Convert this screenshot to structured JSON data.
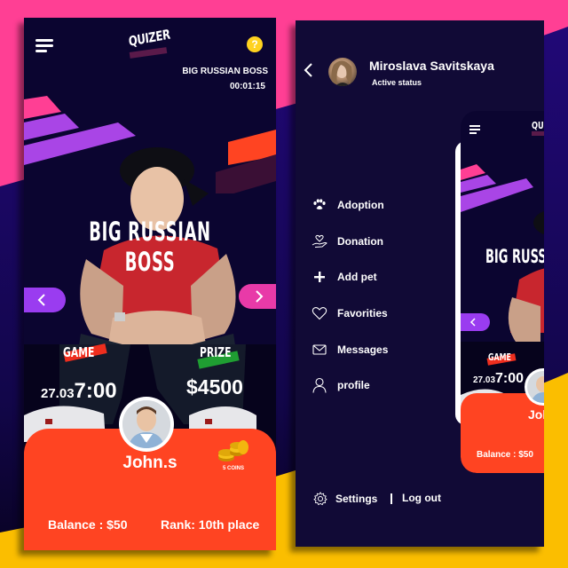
{
  "colors": {
    "bg_pink": "#ff3f94",
    "bg_indigo": "#1a0a5e",
    "bg_yellow": "#fbbe00",
    "phone_dark": "#0b0530",
    "menu_dark": "#110a36",
    "accent_orange": "#ff4422",
    "accent_purple": "#9a3cf0",
    "accent_pink": "#e83aa8",
    "help_yellow": "#ffd21f",
    "game_tag_red": "#ee2e1e",
    "prize_tag_green": "#1f9e32"
  },
  "quiz_screen": {
    "logo": "QUIZER",
    "menu_icon": "hamburger-menu-icon",
    "help_icon": "?",
    "header_title": "BIG RUSSIAN BOSS",
    "timer": "00:01:15",
    "hero_title": "BIG RUSSIAN BOSS",
    "prev_icon": "chevron-left-icon",
    "next_icon": "chevron-right-icon",
    "game": {
      "label": "GAME",
      "date": "27.03",
      "time": "7:00"
    },
    "prize": {
      "label": "PRIZE",
      "value": "$4500"
    },
    "user": {
      "name": "John.s",
      "coins_label": "5 COINS",
      "balance": "Balance : $50",
      "rank": "Rank: 10th place"
    }
  },
  "menu_screen": {
    "back_icon": "chevron-left-icon",
    "profile": {
      "name": "Miroslava Savitskaya",
      "status": "Active status"
    },
    "items": [
      {
        "label": "Adoption",
        "icon": "paw-icon"
      },
      {
        "label": "Donation",
        "icon": "heart-hand-icon"
      },
      {
        "label": "Add pet",
        "icon": "plus-icon"
      },
      {
        "label": "Favorities",
        "icon": "heart-icon"
      },
      {
        "label": "Messages",
        "icon": "envelope-icon"
      },
      {
        "label": "profile",
        "icon": "user-icon"
      }
    ],
    "settings_label": "Settings",
    "logout_label": "Log out",
    "preview": {
      "logo": "QUI",
      "hero_title": "BIG RUSSI",
      "game_label": "GAME",
      "game_date": "27.03",
      "game_time": "7:00",
      "user_name": "Joh",
      "balance": "Balance : $50"
    }
  }
}
